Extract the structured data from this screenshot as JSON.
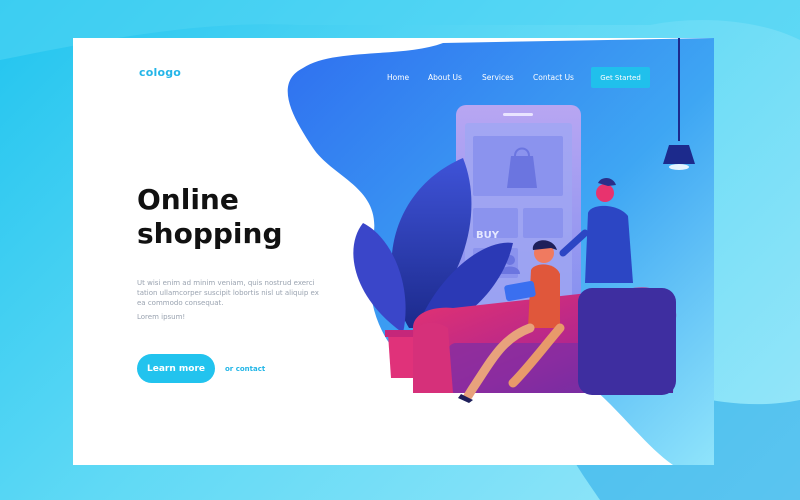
{
  "brand": {
    "logo": "cologo"
  },
  "nav": {
    "items": [
      "Home",
      "About Us",
      "Services",
      "Contact Us"
    ],
    "cta_label": "Get Started"
  },
  "hero": {
    "title_line1": "Online",
    "title_line2": "shopping",
    "body": "Ut wisi enim ad minim veniam, quis nostrud exerci tation ullamcorper suscipit lobortis nisl ut aliquip ex ea commodo consequat.",
    "lorem": "Lorem ipsum!",
    "primary_button": "Learn more",
    "secondary_link": "or contact"
  },
  "illustration": {
    "phone_buy_label": "BUY"
  },
  "colors": {
    "accent": "#22c3ee",
    "blob_blue": "#3d7df0",
    "sofa_magenta": "#d02f8e",
    "text_dark": "#111111",
    "text_muted": "#9aa3b0"
  },
  "icons": [
    "shopping-bag-icon",
    "user-icon",
    "ceiling-lamp-icon"
  ]
}
